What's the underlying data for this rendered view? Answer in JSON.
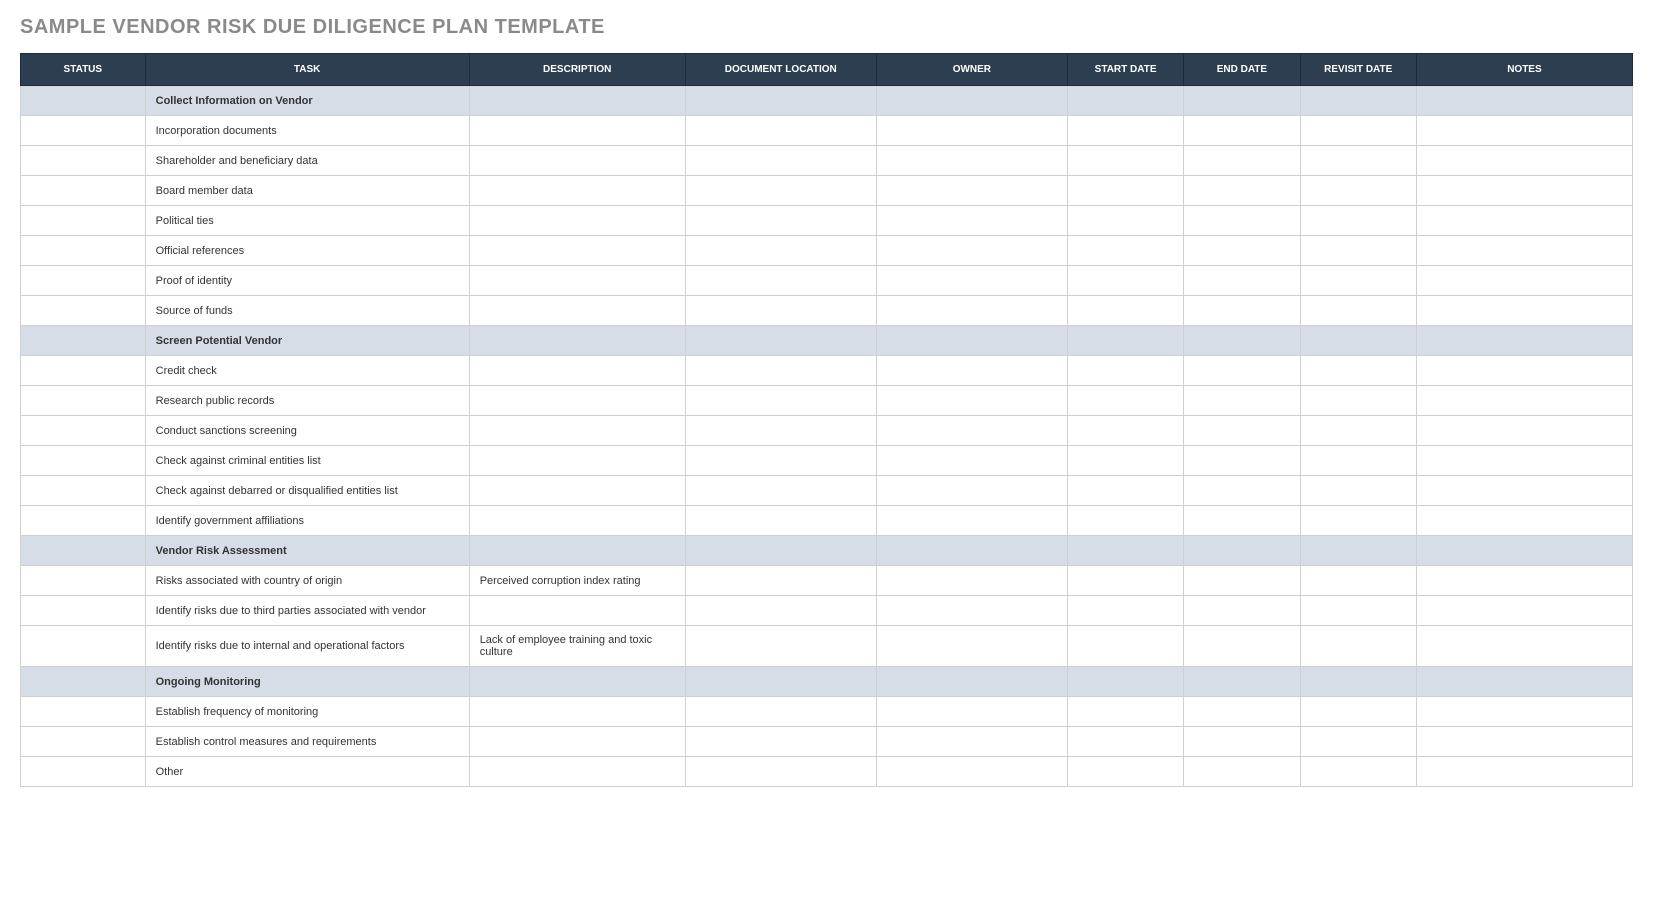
{
  "title": "SAMPLE VENDOR RISK DUE DILIGENCE PLAN TEMPLATE",
  "columns": {
    "status": "STATUS",
    "task": "TASK",
    "description": "DESCRIPTION",
    "document_location": "DOCUMENT LOCATION",
    "owner": "OWNER",
    "start_date": "START DATE",
    "end_date": "END DATE",
    "revisit_date": "REVISIT DATE",
    "notes": "NOTES"
  },
  "rows": [
    {
      "type": "section",
      "task": "Collect Information on Vendor"
    },
    {
      "type": "item",
      "task": "Incorporation documents"
    },
    {
      "type": "item",
      "task": "Shareholder and beneficiary data"
    },
    {
      "type": "item",
      "task": "Board member data"
    },
    {
      "type": "item",
      "task": "Political ties"
    },
    {
      "type": "item",
      "task": "Official references"
    },
    {
      "type": "item",
      "task": "Proof of identity"
    },
    {
      "type": "item",
      "task": "Source of funds"
    },
    {
      "type": "section",
      "task": "Screen Potential Vendor"
    },
    {
      "type": "item",
      "task": "Credit check"
    },
    {
      "type": "item",
      "task": "Research public records"
    },
    {
      "type": "item",
      "task": "Conduct sanctions screening"
    },
    {
      "type": "item",
      "task": "Check against criminal entities list"
    },
    {
      "type": "item",
      "task": "Check against debarred or disqualified entities list"
    },
    {
      "type": "item",
      "task": "Identify government affiliations"
    },
    {
      "type": "section",
      "task": "Vendor Risk Assessment"
    },
    {
      "type": "item",
      "task": "Risks associated with country of origin",
      "description": "Perceived corruption index rating"
    },
    {
      "type": "item",
      "task": "Identify risks due to third parties associated with vendor"
    },
    {
      "type": "item",
      "task": "Identify risks due to internal and operational factors",
      "description": "Lack of employee training and toxic culture"
    },
    {
      "type": "section",
      "task": "Ongoing Monitoring"
    },
    {
      "type": "item",
      "task": "Establish frequency of monitoring"
    },
    {
      "type": "item",
      "task": "Establish control measures and requirements"
    },
    {
      "type": "item",
      "task": "Other"
    }
  ]
}
